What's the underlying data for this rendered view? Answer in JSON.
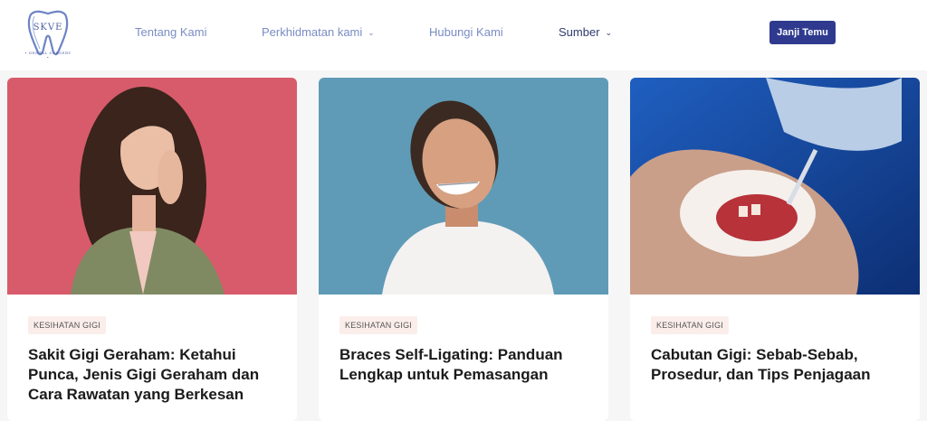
{
  "brand": {
    "logo_text": "SKVE",
    "caption": "• DENTAL SURGERY •"
  },
  "nav": {
    "items": [
      {
        "label": "Tentang Kami",
        "dropdown": false
      },
      {
        "label": "Perkhidmatan kami",
        "dropdown": true
      },
      {
        "label": "Hubungi Kami",
        "dropdown": false
      },
      {
        "label": "Sumber",
        "dropdown": true
      }
    ],
    "cta_label": "Janji Temu"
  },
  "articles": [
    {
      "tag": "KESIHATAN GIGI",
      "title": "Sakit Gigi Geraham: Ketahui Punca, Jenis Gigi Geraham dan Cara Rawatan yang Berkesan",
      "image": "woman-toothache-photo"
    },
    {
      "tag": "KESIHATAN GIGI",
      "title": "Braces Self-Ligating: Panduan Lengkap untuk Pemasangan",
      "image": "smiling-girl-braces-photo"
    },
    {
      "tag": "KESIHATAN GIGI",
      "title": "Cabutan Gigi: Sebab-Sebab, Prosedur, dan Tips Penjagaan",
      "image": "tooth-extraction-photo"
    }
  ],
  "colors": {
    "accent": "#2f3a8f",
    "nav_text": "#7a8cc4",
    "tag_bg": "#fbeeea"
  }
}
